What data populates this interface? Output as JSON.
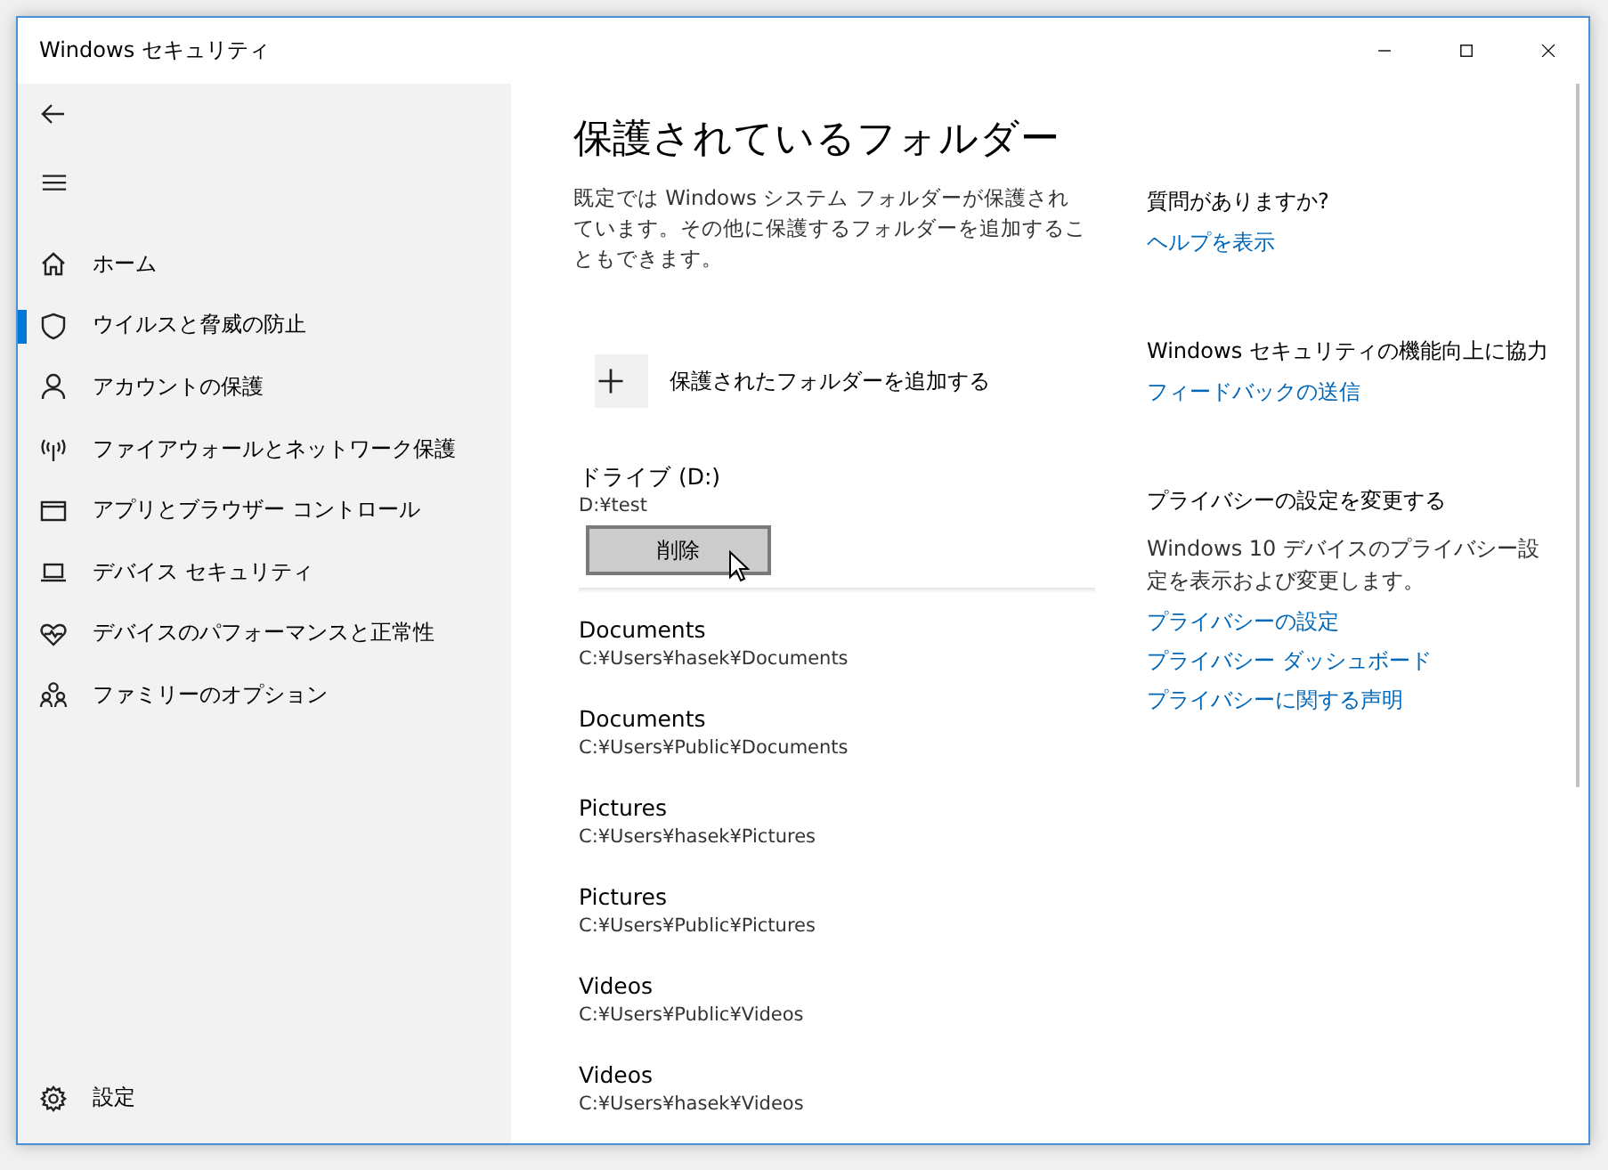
{
  "window": {
    "title": "Windows セキュリティ"
  },
  "sidebar": {
    "items": [
      {
        "label": "ホーム",
        "selected": false
      },
      {
        "label": "ウイルスと脅威の防止",
        "selected": true
      },
      {
        "label": "アカウントの保護",
        "selected": false
      },
      {
        "label": "ファイアウォールとネットワーク保護",
        "selected": false
      },
      {
        "label": "アプリとブラウザー コントロール",
        "selected": false
      },
      {
        "label": "デバイス セキュリティ",
        "selected": false
      },
      {
        "label": "デバイスのパフォーマンスと正常性",
        "selected": false
      },
      {
        "label": "ファミリーのオプション",
        "selected": false
      }
    ],
    "settings": "設定"
  },
  "main": {
    "title": "保護されているフォルダー",
    "description": "既定では Windows システム フォルダーが保護されています。その他に保護するフォルダーを追加することもできます。",
    "add_button": "保護されたフォルダーを追加する",
    "folders": [
      {
        "name": "ドライブ (D:)",
        "path": "D:¥test",
        "expanded": true,
        "button": "削除"
      },
      {
        "name": "Documents",
        "path": "C:¥Users¥hasek¥Documents",
        "expanded": false
      },
      {
        "name": "Documents",
        "path": "C:¥Users¥Public¥Documents",
        "expanded": false
      },
      {
        "name": "Pictures",
        "path": "C:¥Users¥hasek¥Pictures",
        "expanded": false
      },
      {
        "name": "Pictures",
        "path": "C:¥Users¥Public¥Pictures",
        "expanded": false
      },
      {
        "name": "Videos",
        "path": "C:¥Users¥Public¥Videos",
        "expanded": false
      },
      {
        "name": "Videos",
        "path": "C:¥Users¥hasek¥Videos",
        "expanded": false
      }
    ]
  },
  "aside": [
    {
      "heading": "質問がありますか?",
      "links": [
        "ヘルプを表示"
      ]
    },
    {
      "heading": "Windows セキュリティの機能向上に協力",
      "links": [
        "フィードバックの送信"
      ]
    },
    {
      "heading": "プライバシーの設定を変更する",
      "text": "Windows 10 デバイスのプライバシー設定を表示および変更します。",
      "links": [
        "プライバシーの設定",
        "プライバシー ダッシュボード",
        "プライバシーに関する声明"
      ]
    }
  ]
}
